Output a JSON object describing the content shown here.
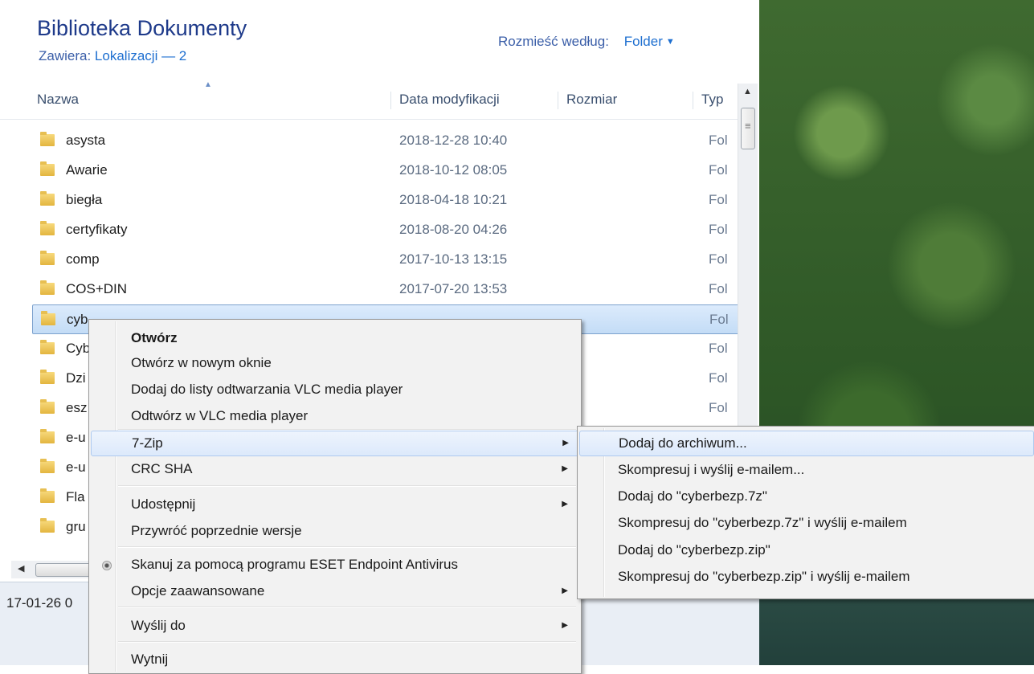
{
  "library": {
    "title": "Biblioteka Dokumenty",
    "contains_label": "Zawiera:",
    "contains_value": "Lokalizacji — 2",
    "arrange_label": "Rozmieść według:",
    "arrange_value": "Folder"
  },
  "columns": {
    "name": "Nazwa",
    "modified": "Data modyfikacji",
    "size": "Rozmiar",
    "type": "Typ"
  },
  "files": [
    {
      "name": "asysta",
      "date": "2018-12-28 10:40",
      "type": "Fol"
    },
    {
      "name": "Awarie",
      "date": "2018-10-12 08:05",
      "type": "Fol"
    },
    {
      "name": "biegła",
      "date": "2018-04-18 10:21",
      "type": "Fol"
    },
    {
      "name": "certyfikaty",
      "date": "2018-08-20 04:26",
      "type": "Fol"
    },
    {
      "name": "comp",
      "date": "2017-10-13 13:15",
      "type": "Fol"
    },
    {
      "name": "COS+DIN",
      "date": "2017-07-20 13:53",
      "type": "Fol"
    },
    {
      "name": "cyb",
      "date": "",
      "type": "Fol"
    },
    {
      "name": "Cyb",
      "date": "",
      "type": "Fol"
    },
    {
      "name": "Dzi",
      "date": "",
      "type": "Fol"
    },
    {
      "name": "esz",
      "date": "",
      "type": "Fol"
    },
    {
      "name": "e-u",
      "date": "",
      "type": ""
    },
    {
      "name": "e-u",
      "date": "",
      "type": ""
    },
    {
      "name": "Fla",
      "date": "",
      "type": ""
    },
    {
      "name": "gru",
      "date": "",
      "type": ""
    }
  ],
  "status": {
    "text": "17-01-26 0"
  },
  "context_menu": {
    "open": "Otwórz",
    "open_new_window": "Otwórz w nowym oknie",
    "vlc_add": "Dodaj do listy odtwarzania VLC media player",
    "vlc_play": "Odtwórz w VLC media player",
    "zip": "7-Zip",
    "crc": "CRC SHA",
    "share": "Udostępnij",
    "restore": "Przywróć poprzednie wersje",
    "eset": "Skanuj za pomocą programu ESET Endpoint Antivirus",
    "advanced": "Opcje zaawansowane",
    "send_to": "Wyślij do",
    "cut": "Wytnij"
  },
  "zip_submenu": {
    "add_archive": "Dodaj do archiwum...",
    "compress_email": "Skompresuj i wyślij e-mailem...",
    "add_7z": "Dodaj do \"cyberbezp.7z\"",
    "compress_7z_email": "Skompresuj do \"cyberbezp.7z\" i wyślij e-mailem",
    "add_zip": "Dodaj do \"cyberbezp.zip\"",
    "compress_zip_email": "Skompresuj do \"cyberbezp.zip\" i wyślij e-mailem"
  }
}
